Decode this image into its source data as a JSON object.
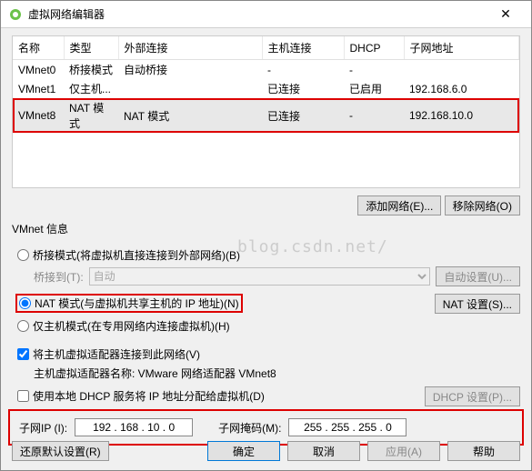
{
  "window": {
    "title": "虚拟网络编辑器"
  },
  "table": {
    "headers": [
      "名称",
      "类型",
      "外部连接",
      "主机连接",
      "DHCP",
      "子网地址"
    ],
    "rows": [
      {
        "name": "VMnet0",
        "type": "桥接模式",
        "ext": "自动桥接",
        "host": "-",
        "dhcp": "-",
        "subnet": ""
      },
      {
        "name": "VMnet1",
        "type": "仅主机...",
        "ext": "",
        "host": "已连接",
        "dhcp": "已启用",
        "subnet": "192.168.6.0"
      },
      {
        "name": "VMnet8",
        "type": "NAT 模式",
        "ext": "NAT 模式",
        "host": "已连接",
        "dhcp": "-",
        "subnet": "192.168.10.0"
      }
    ]
  },
  "buttons": {
    "add_network": "添加网络(E)...",
    "remove_network": "移除网络(O)",
    "auto_settings": "自动设置(U)...",
    "nat_settings": "NAT 设置(S)...",
    "dhcp_settings": "DHCP 设置(P)...",
    "restore_defaults": "还原默认设置(R)",
    "ok": "确定",
    "cancel": "取消",
    "apply": "应用(A)",
    "help": "帮助"
  },
  "info": {
    "section_title": "VMnet 信息",
    "bridge_radio": "桥接模式(将虚拟机直接连接到外部网络)(B)",
    "bridge_to_label": "桥接到(T):",
    "bridge_to_value": "自动",
    "nat_radio": "NAT 模式(与虚拟机共享主机的 IP 地址)(N)",
    "hostonly_radio": "仅主机模式(在专用网络内连接虚拟机)(H)",
    "connect_host_check": "将主机虚拟适配器连接到此网络(V)",
    "adapter_label": "主机虚拟适配器名称: VMware 网络适配器 VMnet8",
    "dhcp_check": "使用本地 DHCP 服务将 IP 地址分配给虚拟机(D)",
    "subnet_ip_label": "子网IP (I):",
    "subnet_ip_value": "192 . 168 . 10 . 0",
    "subnet_mask_label": "子网掩码(M):",
    "subnet_mask_value": "255 . 255 . 255 . 0"
  },
  "watermark": "blog.csdn.net/"
}
